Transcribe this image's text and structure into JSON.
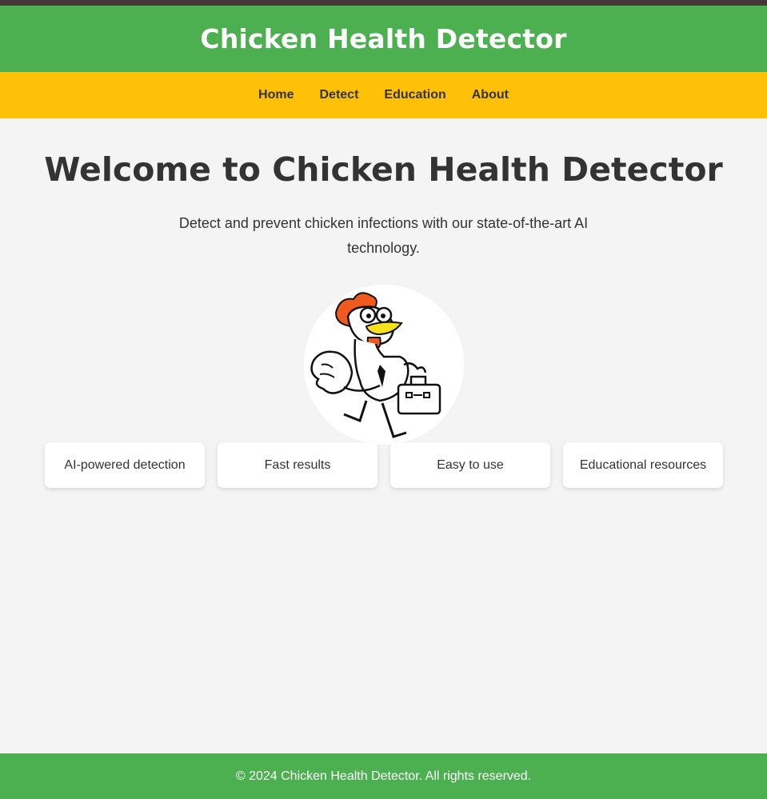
{
  "header": {
    "title": "Chicken Health Detector"
  },
  "nav": {
    "items": [
      {
        "label": "Home"
      },
      {
        "label": "Detect"
      },
      {
        "label": "Education"
      },
      {
        "label": "About"
      }
    ]
  },
  "hero": {
    "title": "Welcome to Chicken Health Detector",
    "description": "Detect and prevent chicken infections with our state-of-the-art AI technology."
  },
  "features": [
    {
      "label": "AI-powered detection"
    },
    {
      "label": "Fast results"
    },
    {
      "label": "Easy to use"
    },
    {
      "label": "Educational resources"
    }
  ],
  "footer": {
    "text": "© 2024 Chicken Health Detector. All rights reserved."
  },
  "colors": {
    "topbar": "#4a3838",
    "header_bg": "#4caf50",
    "nav_bg": "#ffc107",
    "page_bg": "#f4f4f4",
    "footer_bg": "#4caf50"
  }
}
